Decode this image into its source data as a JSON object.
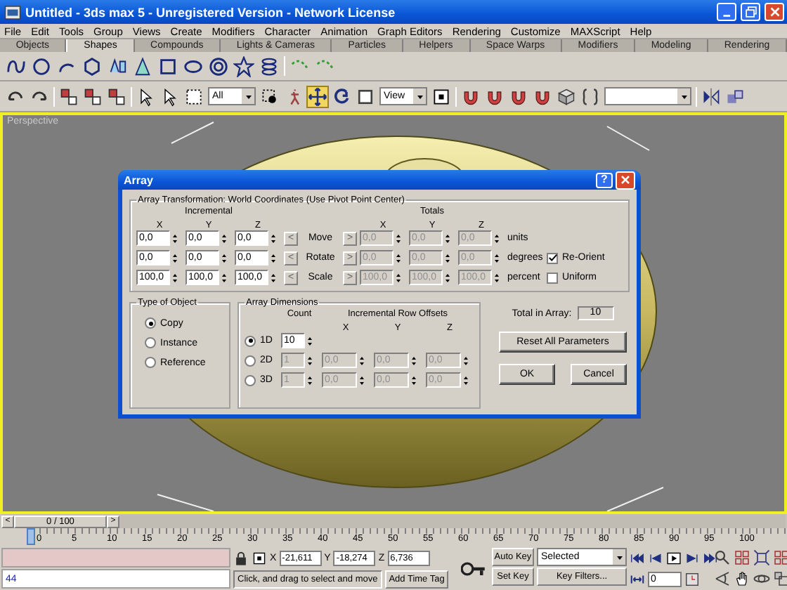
{
  "window": {
    "title": "Untitled - 3ds max 5 - Unregistered Version - Network License"
  },
  "menu": [
    "File",
    "Edit",
    "Tools",
    "Group",
    "Views",
    "Create",
    "Modifiers",
    "Character",
    "Animation",
    "Graph Editors",
    "Rendering",
    "Customize",
    "MAXScript",
    "Help"
  ],
  "tabs": [
    {
      "label": "Objects",
      "selected": false
    },
    {
      "label": "Shapes",
      "selected": true
    },
    {
      "label": "Compounds",
      "selected": false
    },
    {
      "label": "Lights & Cameras",
      "selected": false
    },
    {
      "label": "Particles",
      "selected": false
    },
    {
      "label": "Helpers",
      "selected": false
    },
    {
      "label": "Space Warps",
      "selected": false
    },
    {
      "label": "Modifiers",
      "selected": false
    },
    {
      "label": "Modeling",
      "selected": false
    },
    {
      "label": "Rendering",
      "selected": false
    }
  ],
  "toolbar": {
    "move_active": true,
    "selection_filter": "All",
    "reference_coord": "View"
  },
  "viewport": {
    "label": "Perspective",
    "active": true
  },
  "dialog": {
    "title": "Array",
    "help": "?",
    "transform": {
      "title": "Array Transformation: World Coordinates (Use Pivot Point Center)",
      "incremental_label": "Incremental",
      "totals_label": "Totals",
      "axes": [
        "X",
        "Y",
        "Z"
      ],
      "totals_axes": [
        "X",
        "Y",
        "Z"
      ],
      "rows": [
        {
          "label": "Move",
          "left": "<",
          "right": ">",
          "incremental": [
            "0,0",
            "0,0",
            "0,0"
          ],
          "totals": [
            "0,0",
            "0,0",
            "0,0"
          ],
          "totals_disabled": true,
          "unit": "units"
        },
        {
          "label": "Rotate",
          "left": "<",
          "right": ">",
          "incremental": [
            "0,0",
            "0,0",
            "0,0"
          ],
          "totals": [
            "0,0",
            "0,0",
            "0,0"
          ],
          "totals_disabled": true,
          "unit": "degrees",
          "option": {
            "label": "Re-Orient",
            "checked": true
          }
        },
        {
          "label": "Scale",
          "left": "<",
          "right": ">",
          "incremental": [
            "100,0",
            "100,0",
            "100,0"
          ],
          "totals": [
            "100,0",
            "100,0",
            "100,0"
          ],
          "totals_disabled": true,
          "unit": "percent",
          "option": {
            "label": "Uniform",
            "checked": false
          }
        }
      ]
    },
    "type_of_object": {
      "title": "Type of Object",
      "options": [
        {
          "label": "Copy",
          "selected": true
        },
        {
          "label": "Instance",
          "selected": false
        },
        {
          "label": "Reference",
          "selected": false
        }
      ]
    },
    "dimensions": {
      "title": "Array Dimensions",
      "count_label": "Count",
      "offsets_label": "Incremental Row Offsets",
      "axes": [
        "X",
        "Y",
        "Z"
      ],
      "rows": [
        {
          "label": "1D",
          "selected": true,
          "disabled": false,
          "count": "10"
        },
        {
          "label": "2D",
          "selected": false,
          "disabled": true,
          "count": "1",
          "offsets": [
            "0,0",
            "0,0",
            "0,0"
          ]
        },
        {
          "label": "3D",
          "selected": false,
          "disabled": true,
          "count": "1",
          "offsets": [
            "0,0",
            "0,0",
            "0,0"
          ]
        }
      ]
    },
    "total": {
      "label": "Total in Array:",
      "value": "10"
    },
    "reset": "Reset All Parameters",
    "ok": "OK",
    "cancel": "Cancel"
  },
  "timeline": {
    "position": "0 / 100",
    "prev": "<",
    "next": ">",
    "ticks": [
      "0",
      "5",
      "10",
      "15",
      "20",
      "25",
      "30",
      "35",
      "40",
      "45",
      "50",
      "55",
      "60",
      "65",
      "70",
      "75",
      "80",
      "85",
      "90",
      "95",
      "100"
    ]
  },
  "status": {
    "script_line": "44",
    "coords": [
      {
        "axis": "X",
        "value": "-21,611"
      },
      {
        "axis": "Y",
        "value": "-18,274"
      },
      {
        "axis": "Z",
        "value": "6,736"
      }
    ],
    "prompt": "Click, and drag to select and move",
    "time_tag": "Add Time Tag",
    "auto_key": "Auto Key",
    "set_key": "Set Key",
    "key_mode": "Selected",
    "key_filters": "Key Filters...",
    "frame": "0"
  }
}
